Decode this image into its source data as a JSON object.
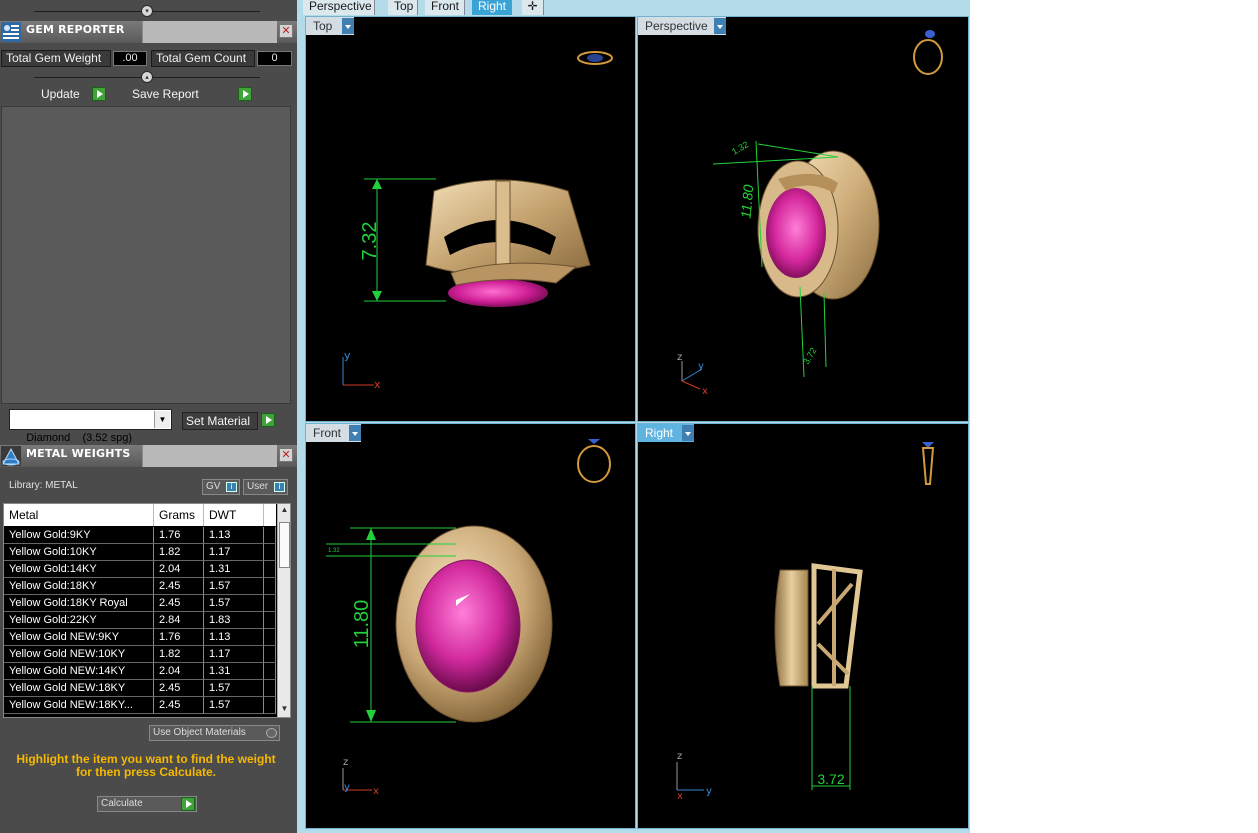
{
  "gem_reporter": {
    "title": "GEM REPORTER",
    "total_weight_label": "Total Gem Weight",
    "total_weight_value": ".00",
    "total_count_label": "Total Gem Count",
    "total_count_value": "0",
    "update_label": "Update",
    "save_report_label": "Save Report",
    "material_select": "Diamond    (3.52 spg)",
    "set_material_label": "Set Material"
  },
  "metal_weights": {
    "title": "METAL WEIGHTS",
    "library_label": "Library: METAL",
    "gv_label": "GV",
    "user_label": "User",
    "columns": [
      "Metal",
      "Grams",
      "DWT"
    ],
    "rows": [
      [
        "Yellow Gold:9KY",
        "1.76",
        "1.13"
      ],
      [
        "Yellow Gold:10KY",
        "1.82",
        "1.17"
      ],
      [
        "Yellow Gold:14KY",
        "2.04",
        "1.31"
      ],
      [
        "Yellow Gold:18KY",
        "2.45",
        "1.57"
      ],
      [
        "Yellow Gold:18KY Royal",
        "2.45",
        "1.57"
      ],
      [
        "Yellow Gold:22KY",
        "2.84",
        "1.83"
      ],
      [
        "Yellow Gold NEW:9KY",
        "1.76",
        "1.13"
      ],
      [
        "Yellow Gold NEW:10KY",
        "1.82",
        "1.17"
      ],
      [
        "Yellow Gold NEW:14KY",
        "2.04",
        "1.31"
      ],
      [
        "Yellow Gold NEW:18KY",
        "2.45",
        "1.57"
      ],
      [
        "Yellow Gold NEW:18KY...",
        "2.45",
        "1.57"
      ]
    ],
    "use_object_materials_label": "Use Object Materials",
    "hint_line1": "Highlight the item you want to find the weight",
    "hint_line2": "for then press Calculate.",
    "calculate_label": "Calculate"
  },
  "tabs": [
    "Perspective",
    "Top",
    "Front",
    "Right"
  ],
  "active_tab": "Right",
  "viewports": {
    "top": {
      "label": "Top",
      "dimension": "7.32",
      "axis_a": "y",
      "axis_b": "x"
    },
    "perspective": {
      "label": "Perspective",
      "dim_height": "11.80",
      "dim_small": "1.32",
      "dim_width": "3.72",
      "axis_a": "z",
      "axis_b": "y",
      "axis_c": "x"
    },
    "front": {
      "label": "Front",
      "dimension": "11.80",
      "dim_small": "1.32",
      "axis_a": "z",
      "axis_b": "y",
      "axis_c": "x"
    },
    "right": {
      "label": "Right",
      "dimension": "3.72",
      "axis_a": "z",
      "axis_b": "x",
      "axis_c": "y"
    }
  },
  "colors": {
    "gold": "#c9ab7a",
    "gem": "#d4279c",
    "dimension": "#22d03a",
    "axis_x": "#d23a2a",
    "axis_y": "#3a8ad8",
    "hint": "#f6b900"
  }
}
